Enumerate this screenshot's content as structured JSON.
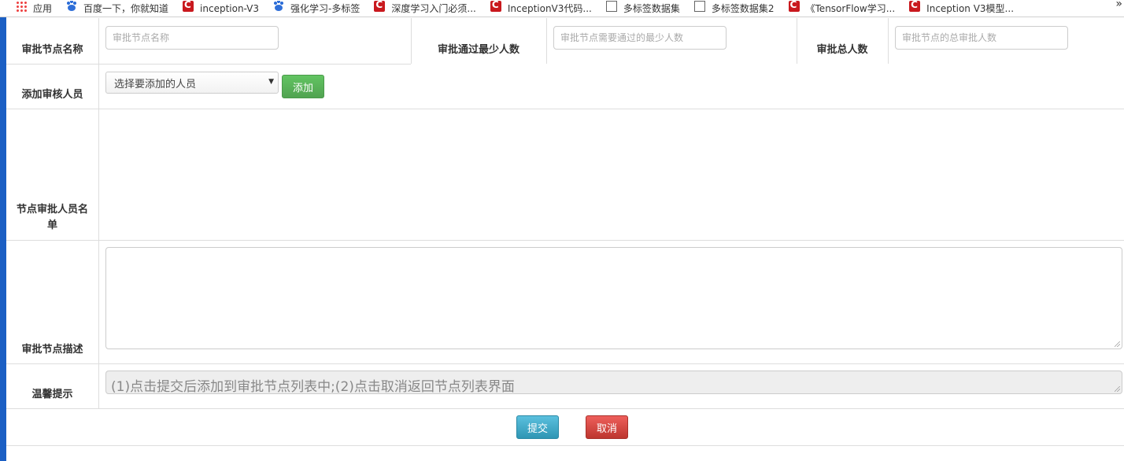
{
  "bookmarks": [
    {
      "label": "应用",
      "icon": "apps-grid-icon"
    },
    {
      "label": "百度一下，你就知道",
      "icon": "baidu-paw-icon"
    },
    {
      "label": "inception-V3",
      "icon": "csdn-icon"
    },
    {
      "label": "强化学习-多标签",
      "icon": "baidu-paw-icon"
    },
    {
      "label": "深度学习入门必须...",
      "icon": "csdn-icon"
    },
    {
      "label": "InceptionV3代码...",
      "icon": "csdn-icon"
    },
    {
      "label": "多标签数据集",
      "icon": "document-icon"
    },
    {
      "label": "多标签数据集2",
      "icon": "document-icon"
    },
    {
      "label": "《TensorFlow学习...",
      "icon": "csdn-icon"
    },
    {
      "label": "Inception V3模型...",
      "icon": "csdn-icon"
    }
  ],
  "bookmarks_more": "»",
  "form": {
    "node_name_label": "审批节点名称",
    "node_name_placeholder": "审批节点名称",
    "min_pass_label": "审批通过最少人数",
    "min_pass_placeholder": "审批节点需要通过的最少人数",
    "total_label": "审批总人数",
    "total_placeholder": "审批节点的总审批人数",
    "add_reviewer_label": "添加审核人员",
    "reviewer_select_value": "选择要添加的人员",
    "add_button": "添加",
    "reviewer_list_label": "节点审批人员名单",
    "description_label": "审批节点描述",
    "tip_label": "温馨提示",
    "tip_text": "(1)点击提交后添加到审批节点列表中;(2)点击取消返回节点列表界面",
    "submit_button": "提交",
    "cancel_button": "取消"
  },
  "colors": {
    "accent_blue": "#1b5fc4",
    "add_green": "#5cb85c",
    "submit_blue": "#46b0cf",
    "cancel_red": "#d9534f"
  }
}
